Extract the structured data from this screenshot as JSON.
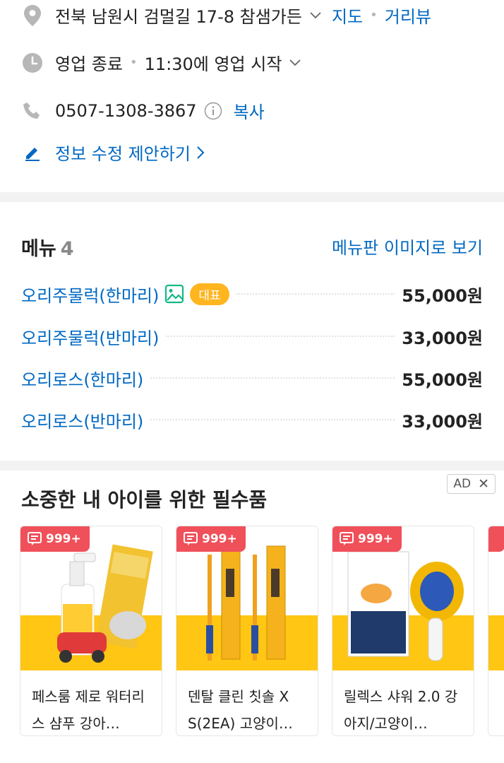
{
  "info": {
    "address": "전북 남원시 검멀길 17-8 참샘가든",
    "map_label": "지도",
    "roadview_label": "거리뷰",
    "hours_status": "영업 종료",
    "hours_next": "11:30에 영업 시작",
    "phone": "0507-1308-3867",
    "copy_label": "복사",
    "suggest_edit": "정보 수정 제안하기"
  },
  "menu": {
    "title": "메뉴",
    "count": "4",
    "board_link": "메뉴판 이미지로 보기",
    "rep_badge": "대표",
    "items": [
      {
        "name": "오리주물럭(한마리)",
        "price": "55,000원"
      },
      {
        "name": "오리주물럭(반마리)",
        "price": "33,000원"
      },
      {
        "name": "오리로스(한마리)",
        "price": "55,000원"
      },
      {
        "name": "오리로스(반마리)",
        "price": "33,000원"
      }
    ]
  },
  "ad": {
    "title": "소중한 내 아이를 위한 필수품",
    "badge": "AD",
    "close": "✕",
    "products": [
      {
        "review": "999+",
        "name": "페스룸 제로 워터리스 샴푸 강아…"
      },
      {
        "review": "999+",
        "name": "덴탈 클린 칫솔 X S(2EA) 고양이…"
      },
      {
        "review": "999+",
        "name": "릴렉스 샤워 2.0 강아지/고양이…"
      }
    ]
  },
  "colors": {
    "link": "#0068c3",
    "accent_badge": "#ffb51f",
    "review_badge": "#f0505a",
    "product_bg": "#ffc614"
  }
}
